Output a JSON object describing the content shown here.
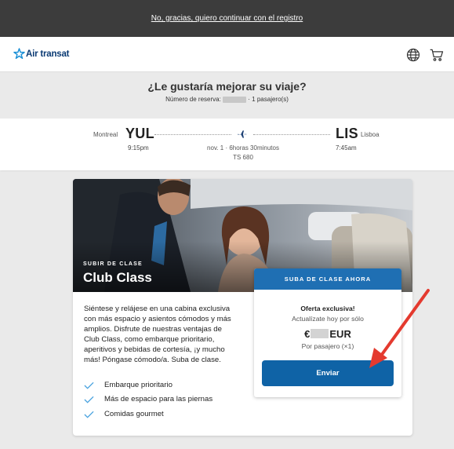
{
  "topbar": {
    "link": "No, gracias, quiero continuar con el registro"
  },
  "header": {
    "brand": "Air transat",
    "icons": [
      "globe-icon",
      "cart-icon"
    ]
  },
  "hero": {
    "title": "¿Le gustaría mejorar su viaje?",
    "booking_label": "Número de reserva:",
    "passengers": "· 1 pasajero(s)"
  },
  "flight": {
    "origin_city": "Montreal",
    "origin_code": "YUL",
    "depart_time": "9:15pm",
    "dest_code": "LIS",
    "dest_city": "Lisboa",
    "arrive_time": "7:45am",
    "date_duration": "nov. 1 · 6horas 30minutos",
    "flight_no": "TS 680"
  },
  "card": {
    "eyebrow": "SUBIR DE CLASE",
    "title": "Club Class",
    "description": "Siéntese y relájese en una cabina exclusiva con más espacio y asientos cómodos y más amplios. Disfrute de nuestras ventajas de Club Class, como embarque prioritario, aperitivos y bebidas de cortesía, ¡y mucho más! Póngase cómodo/a. Suba de clase.",
    "features": [
      "Embarque prioritario",
      "Más de espacio para las piernas",
      "Comidas gourmet"
    ]
  },
  "offer": {
    "header": "SUBA DE CLASE AHORA",
    "title": "Oferta exclusiva!",
    "subtitle": "Actualízate hoy por sólo",
    "currency_symbol": "€",
    "currency": "EUR",
    "per": "Por pasajero (×1)",
    "button": "Enviar"
  },
  "colors": {
    "topbar": "#3c3c3c",
    "brand": "#0a3a73",
    "accent": "#1f6fb3",
    "button": "#0f63a6",
    "check": "#4aa3df",
    "annotation_arrow": "#e43a2f"
  }
}
